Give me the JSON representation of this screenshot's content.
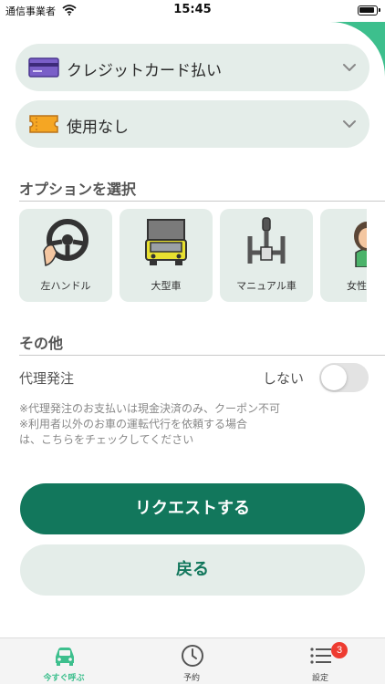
{
  "status_bar": {
    "carrier": "通信事業者",
    "time": "15:45"
  },
  "payment": {
    "label": "クレジットカード払い",
    "icon": "credit-card-icon"
  },
  "coupon": {
    "label": "使用なし",
    "icon": "ticket-icon"
  },
  "options": {
    "title": "オプションを選択",
    "items": [
      {
        "label": "左ハンドル",
        "icon": "steering-wheel-icon"
      },
      {
        "label": "大型車",
        "icon": "truck-icon"
      },
      {
        "label": "マニュアル車",
        "icon": "gear-shift-icon"
      },
      {
        "label": "女性ドラ",
        "icon": "female-driver-icon"
      }
    ]
  },
  "other": {
    "title": "その他",
    "agent_label": "代理発注",
    "agent_value": "しない",
    "agent_enabled": false,
    "notes": [
      "※代理発注のお支払いは現金決済のみ、クーポン不可",
      "※利用者以外のお車の運転代行を依頼する場合",
      "は、こちらをチェックしてください"
    ]
  },
  "buttons": {
    "request": "リクエストする",
    "back": "戻る"
  },
  "tabbar": {
    "items": [
      {
        "label": "今すぐ呼ぶ",
        "icon": "car-icon",
        "active": true
      },
      {
        "label": "予約",
        "icon": "clock-icon",
        "active": false
      },
      {
        "label": "設定",
        "icon": "list-icon",
        "active": false,
        "badge": "3"
      }
    ]
  },
  "colors": {
    "accent": "#3dbf8d",
    "primary_button": "#12775c",
    "pill_background": "#e4ede9",
    "badge": "#ee3b30"
  }
}
